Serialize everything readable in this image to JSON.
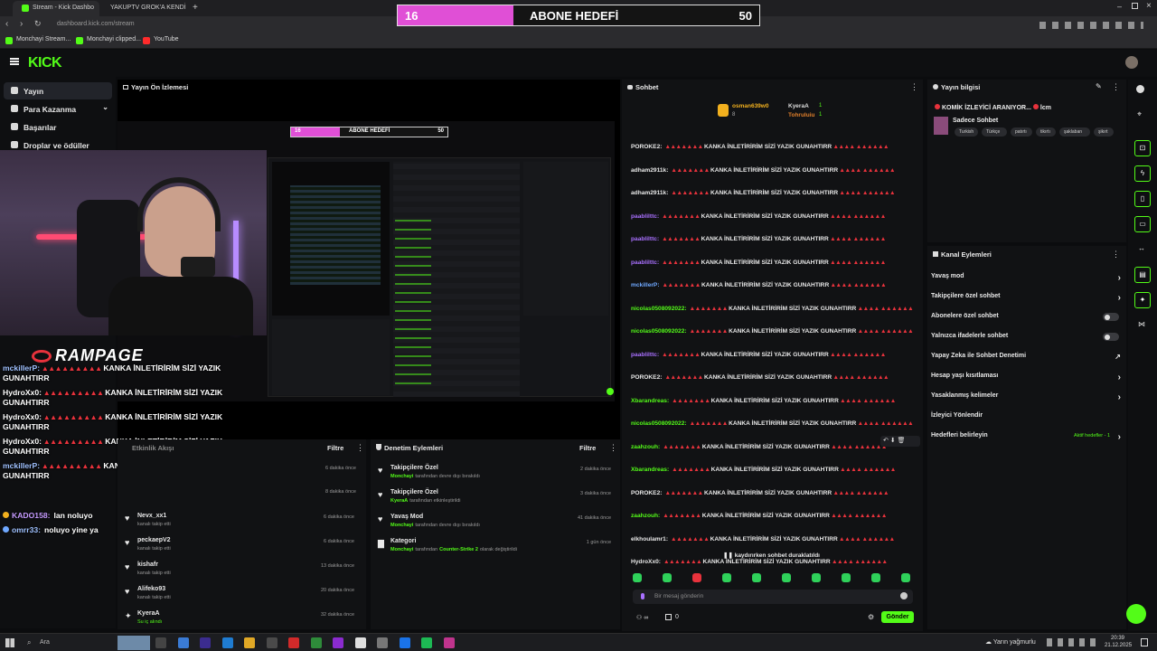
{
  "browser": {
    "tabs": [
      {
        "title": "Stream - Kick Dashbo",
        "active": true,
        "color": "#53fc18"
      },
      {
        "title": "YAKUPTV GROK'A KENDİ",
        "active": false,
        "color": "#e8323c"
      }
    ],
    "url": "dashboard.kick.com/stream",
    "bookmarks": [
      "Monchayi Stream...",
      "Monchayi clipped...",
      "YouTube"
    ]
  },
  "goal_banner": {
    "current": "16",
    "label": "ABONE HEDEFİ",
    "target": "50",
    "progress": 0.32
  },
  "logo": "KICK",
  "sidebar": {
    "items": [
      {
        "label": "Yayın",
        "active": true
      },
      {
        "label": "Para Kazanma",
        "expand": true
      },
      {
        "label": "Başarılar"
      },
      {
        "label": "Droplar ve ödüller"
      }
    ]
  },
  "preview": {
    "title": "Yayın Ön İzlemesi",
    "overlay_brand": "RAMPAGE",
    "mini_goal": {
      "current": "16",
      "label": "ABONE HEDEFİ",
      "target": "50"
    },
    "overlay_chat": [
      {
        "user": "mckillerP:",
        "text": "KANKA İNLETİRİRİM SİZİ YAZIK GUNAHTIRR"
      },
      {
        "user": "HydroXx0:",
        "text": "KANKA İNLETİRİRİM SİZİ YAZIK GUNAHTIRR"
      },
      {
        "user": "HydroXx0:",
        "text": "KANKA İNLETİRİRİM SİZİ YAZIK GUNAHTIRR"
      },
      {
        "user": "HydroXx0:",
        "text": "KANKA İNLETİRİRİM SİZİ YAZIK GUNAHTIRR"
      },
      {
        "user": "mckillerP:",
        "text": "KANKA İNLETİRİRİM SİZİ YAZIK GUNAHTIRR"
      }
    ],
    "overlay_chat_plain": [
      {
        "user": "KADO158:",
        "text": "lan noluyo"
      },
      {
        "user": "omrr33:",
        "text": "noluyo yine ya"
      }
    ]
  },
  "activity": {
    "title": "Etkinlik Akışı",
    "filter": "Filtre",
    "items": [
      {
        "name": "Nevx_xx1",
        "sub": "kanalı takip etti",
        "time": "6 dakika önce"
      },
      {
        "name": "peckaepV2",
        "sub": "kanalı takip etti",
        "time": "6 dakika önce"
      },
      {
        "name": "kishafr",
        "sub": "kanalı takip etti",
        "time": "13 dakika önce"
      },
      {
        "name": "Alifeko93",
        "sub": "kanalı takip etti",
        "time": "20 dakika önce"
      },
      {
        "name": "KyeraA",
        "sub": "Su iç alındı",
        "time": "32 dakika önce"
      }
    ],
    "hidden_times": [
      "6 dakika önce",
      "8 dakika önce"
    ]
  },
  "moderation": {
    "title": "Denetim Eylemleri",
    "filter": "Filtre",
    "items": [
      {
        "name": "Takipçilere Özel",
        "who": "Monchayi",
        "sub": "tarafından devre dışı bırakıldı",
        "time": "2 dakika önce"
      },
      {
        "name": "Takipçilere Özel",
        "who": "KyeraA",
        "sub": "tarafından etkinleştirildi",
        "time": "3 dakika önce"
      },
      {
        "name": "Yavaş Mod",
        "who": "Monchayi",
        "sub": "tarafından devre dışı bırakıldı",
        "time": "41 dakika önce"
      },
      {
        "name": "Kategori",
        "who": "Monchayi",
        "sub": "tarafından",
        "who2": "Counter-Strike 2",
        "sub2": "olarak değiştirildi",
        "time": "1 gün önce"
      }
    ]
  },
  "chat": {
    "title": "Sohbet",
    "pinned": {
      "top1": "osman639w0",
      "top1_count": "8",
      "top2": "KyeraA",
      "top2_count": "1",
      "top3": "Tohruluiu",
      "top3_count": "1"
    },
    "message_text": "KANKA İNLETİRİRİM SİZİ YAZIK GUNAHTIRR",
    "messages": [
      {
        "user": "POROKE2:",
        "color": "#e8e8e8"
      },
      {
        "user": "adham2911k:",
        "color": "#e8e8e8"
      },
      {
        "user": "adham2911k:",
        "color": "#e8e8e8"
      },
      {
        "user": "paablilttc:",
        "color": "#a970ff"
      },
      {
        "user": "paablilttc:",
        "color": "#a970ff"
      },
      {
        "user": "paablilttc:",
        "color": "#a970ff"
      },
      {
        "user": "mckillerP:",
        "color": "#6fa8ff"
      },
      {
        "user": "nicolas0508092022:",
        "color": "#53fc18"
      },
      {
        "user": "nicolas0508092022:",
        "color": "#53fc18"
      },
      {
        "user": "paablilttc:",
        "color": "#a970ff"
      },
      {
        "user": "POROKE2:",
        "color": "#e8e8e8"
      },
      {
        "user": "Xbarandreas:",
        "color": "#53fc18"
      },
      {
        "user": "nicolas0508092022:",
        "color": "#53fc18"
      },
      {
        "user": "zaahzouh:",
        "color": "#53fc18"
      },
      {
        "user": "Xbarandreas:",
        "color": "#53fc18"
      },
      {
        "user": "POROKE2:",
        "color": "#e8e8e8"
      },
      {
        "user": "zaahzouh:",
        "color": "#53fc18"
      },
      {
        "user": "elkhoulamr1:",
        "color": "#e8e8e8"
      },
      {
        "user": "HydroXx0:",
        "color": "#e8e8e8"
      }
    ],
    "paused": "kaydırırken sohbet duraklatıldı",
    "input_placeholder": "Bir mesaj gönderin",
    "send": "Gönder",
    "count": "0"
  },
  "stream_info": {
    "title": "Yayın bilgisi",
    "stream_title": "KOMİK İZLEYİCİ ARANIYOR...",
    "stream_title_tail": "lcm",
    "category": "Sadece Sohbet",
    "tags": [
      "Turkish",
      "Türkçe",
      "patırtı",
      "tikırtı",
      "şaklaban",
      "şikırt"
    ]
  },
  "channel_actions": {
    "title": "Kanal Eylemleri",
    "items": [
      {
        "label": "Yavaş mod",
        "control": "chevron"
      },
      {
        "label": "Takipçilere özel sohbet",
        "control": "chevron"
      },
      {
        "label": "Abonelere özel sohbet",
        "control": "toggle"
      },
      {
        "label": "Yalnızca ifadelerle sohbet",
        "control": "toggle"
      },
      {
        "label": "Yapay Zeka ile Sohbet Denetimi",
        "control": "external"
      },
      {
        "label": "Hesap yaşı kısıtlaması",
        "control": "chevron"
      },
      {
        "label": "Yasaklanmış kelimeler",
        "control": "chevron"
      },
      {
        "label": "İzleyici Yönlendir",
        "control": "none"
      },
      {
        "label": "Hedefleri belirleyin",
        "control": "chevron",
        "extra": "Aktif hedefler - 1"
      }
    ]
  },
  "taskbar": {
    "search": "Ara",
    "weather": "Yarın yağmurlu",
    "time": "20:39",
    "date": "21.12.2025"
  }
}
